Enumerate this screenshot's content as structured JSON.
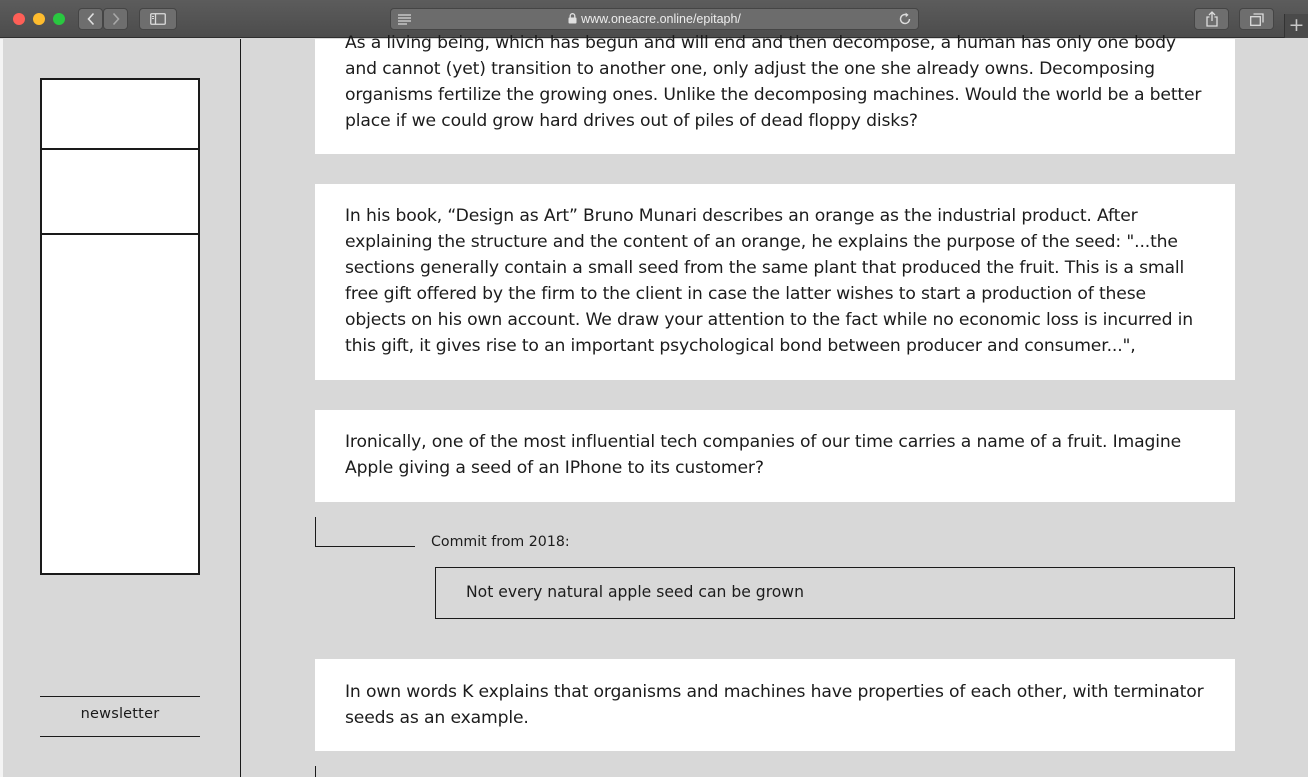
{
  "browser": {
    "url": "www.oneacre.online/epitaph/"
  },
  "sidebar": {
    "newsletter_label": "newsletter"
  },
  "content": {
    "paragraph_1": "As a living being, which has begun and will end and then decompose, a human has only one body and cannot (yet) transition to another one, only adjust the one she already owns. Decomposing organisms fertilize the growing ones. Unlike the decomposing machines. Would the world be a better place if we could grow hard drives out of piles of dead floppy disks?",
    "paragraph_2": "In his book, “Design as Art” Bruno Munari describes an orange as the industrial product. After explaining the structure and the content of an orange, he explains the purpose of the seed: \"...the sections generally contain a small seed from the same plant that produced the fruit. This is a small free gift offered by the firm to the client in case the latter wishes to start a production of these objects on his own account. We draw your attention to the fact while no economic loss is incurred in this gift, it gives rise to an important psychological bond between producer and consumer...\",",
    "paragraph_3": "Ironically, one of the most influential tech companies of our time carries a name of a fruit. Imagine Apple giving a seed of an IPhone to its customer?",
    "commit_label": "Commit from 2018:",
    "commit_text": "Not every natural apple seed can be grown",
    "paragraph_4": "In own words K explains that organisms and machines have properties of each other, with terminator seeds as an example."
  }
}
